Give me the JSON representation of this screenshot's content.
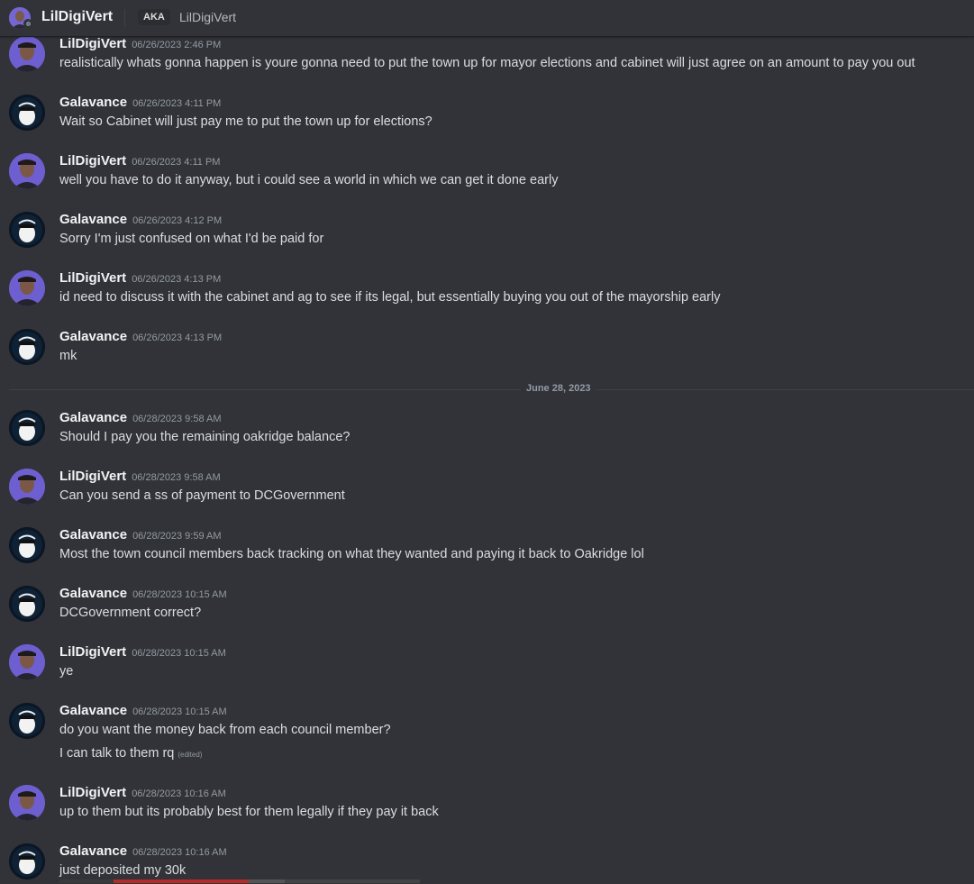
{
  "header": {
    "title": "LilDigiVert",
    "aka_label": "AKA",
    "aka_name": "LilDigiVert"
  },
  "date_divider": "June 28, 2023",
  "messages": [
    {
      "author": "LilDigiVert",
      "time": "06/26/2023 2:46 PM",
      "text": "realistically whats gonna happen is youre gonna need to put the town up for mayor elections and cabinet will just agree on an amount to pay you out"
    },
    {
      "author": "Galavance",
      "time": "06/26/2023 4:11 PM",
      "text": "Wait so Cabinet will just pay me to put the town up for elections?"
    },
    {
      "author": "LilDigiVert",
      "time": "06/26/2023 4:11 PM",
      "text": "well you have to do it anyway, but i could see a world in which we can get it done early"
    },
    {
      "author": "Galavance",
      "time": "06/26/2023 4:12 PM",
      "text": "Sorry I'm just confused on what I'd be paid for"
    },
    {
      "author": "LilDigiVert",
      "time": "06/26/2023 4:13 PM",
      "text": "id need to discuss it with the cabinet and ag to see if its legal, but essentially buying you out of the mayorship early"
    },
    {
      "author": "Galavance",
      "time": "06/26/2023 4:13 PM",
      "text": "mk"
    },
    {
      "author": "Galavance",
      "time": "06/28/2023 9:58 AM",
      "text": "Should I pay you the remaining oakridge balance?"
    },
    {
      "author": "LilDigiVert",
      "time": "06/28/2023 9:58 AM",
      "text": "Can you send a ss of payment to DCGovernment"
    },
    {
      "author": "Galavance",
      "time": "06/28/2023 9:59 AM",
      "text": "Most the town council members back tracking on what they wanted and paying it back to Oakridge lol"
    },
    {
      "author": "Galavance",
      "time": "06/28/2023 10:15 AM",
      "text": "DCGovernment correct?"
    },
    {
      "author": "LilDigiVert",
      "time": "06/28/2023 10:15 AM",
      "text": "ye"
    },
    {
      "author": "Galavance",
      "time": "06/28/2023 10:15 AM",
      "text": "do you want the money back from each council member?",
      "followup": "I can talk to them rq",
      "edited": "(edited)"
    },
    {
      "author": "LilDigiVert",
      "time": "06/28/2023 10:16 AM",
      "text": "up to them but its probably best for them legally if they pay it back"
    },
    {
      "author": "Galavance",
      "time": "06/28/2023 10:16 AM",
      "text": "just deposited my 30k"
    }
  ]
}
